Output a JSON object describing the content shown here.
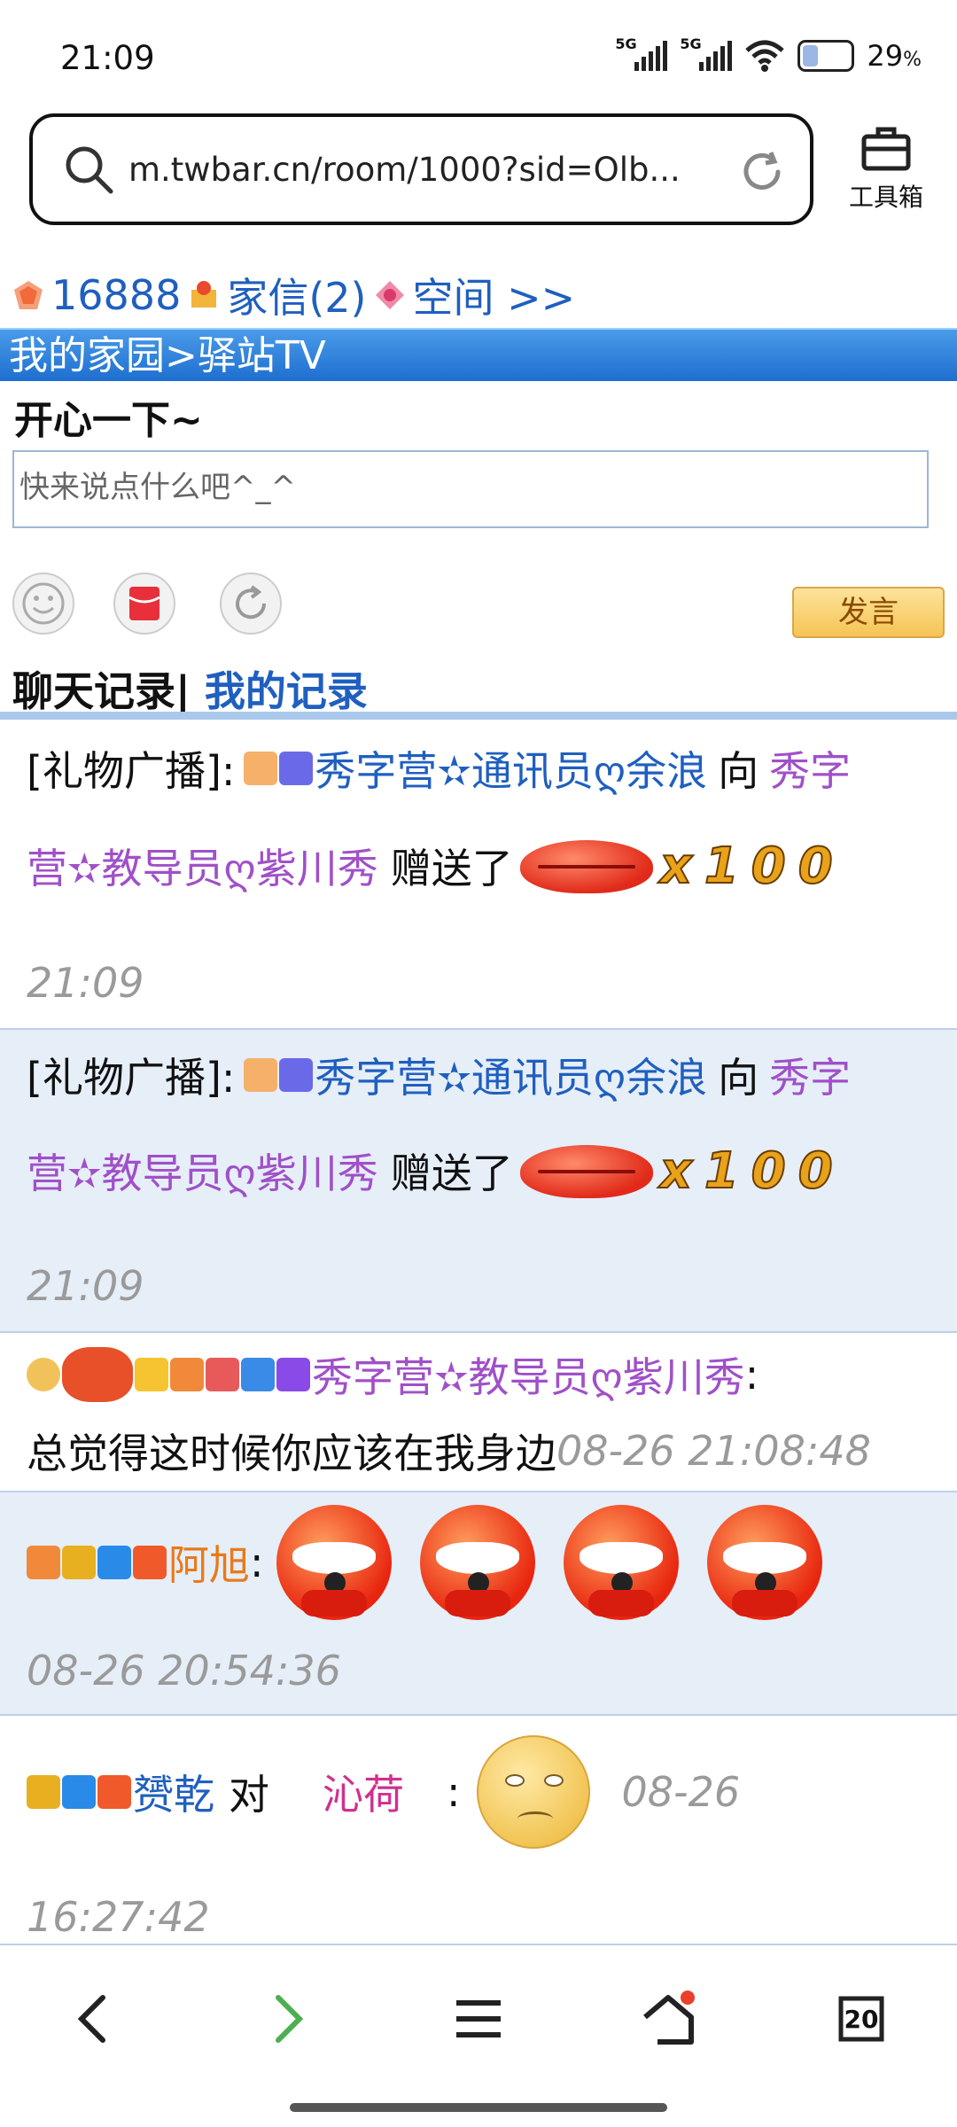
{
  "status": {
    "time": "21:09",
    "net1": "5G",
    "net2": "5G",
    "battery": "29",
    "battery_unit": "%",
    "battery_level": 0.29
  },
  "browser": {
    "url": "m.twbar.cn/room/1000?sid=Olb...",
    "toolbox_label": "工具箱",
    "tabs_count": "20"
  },
  "top": {
    "coins": "16888",
    "mail": "家信(2)",
    "space": "空间 >>"
  },
  "breadcrumb": "我的家园>驿站TV",
  "compose": {
    "title": "开心一下~",
    "placeholder": "快来说点什么吧^_^",
    "send": "发言"
  },
  "tabs": {
    "chat": "聊天记录",
    "sep": "|",
    "mine": "我的记录"
  },
  "messages": [
    {
      "prefix": "[礼物广播]:",
      "from": "秀字营✫通讯员ღ余浪",
      "verb": "向",
      "to_a": "秀字",
      "to_b": "营✫教导员ღ紫川秀",
      "action": "赠送了",
      "count": "x100",
      "time": "21:09"
    },
    {
      "prefix": "[礼物广播]:",
      "from": "秀字营✫通讯员ღ余浪",
      "verb": "向",
      "to_a": "秀字",
      "to_b": "营✫教导员ღ紫川秀",
      "action": "赠送了",
      "count": "x100",
      "time": "21:09"
    },
    {
      "user": "秀字营✫教导员ღ紫川秀",
      "colon": ":",
      "text": "总觉得这时候你应该在我身边",
      "time": "08-26 21:08:48"
    },
    {
      "user": "阿旭",
      "colon": ":",
      "time": "08-26 20:54:36"
    },
    {
      "user": "赟乾",
      "verb": "对",
      "target": "沁荷",
      "colon": ":",
      "time_a": "08-26",
      "time_b": "16:27:42"
    }
  ],
  "colors": {
    "link_blue": "#1f5fbf",
    "purple": "#a050c8",
    "orange": "#e87a1a",
    "bar_blue": "#1e6fd0"
  },
  "icons": [
    "search-icon",
    "reload-icon",
    "toolbox-icon",
    "smile-icon",
    "red-packet-icon",
    "refresh-icon",
    "back-icon",
    "forward-icon",
    "menu-icon",
    "home-icon",
    "tabs-icon"
  ]
}
